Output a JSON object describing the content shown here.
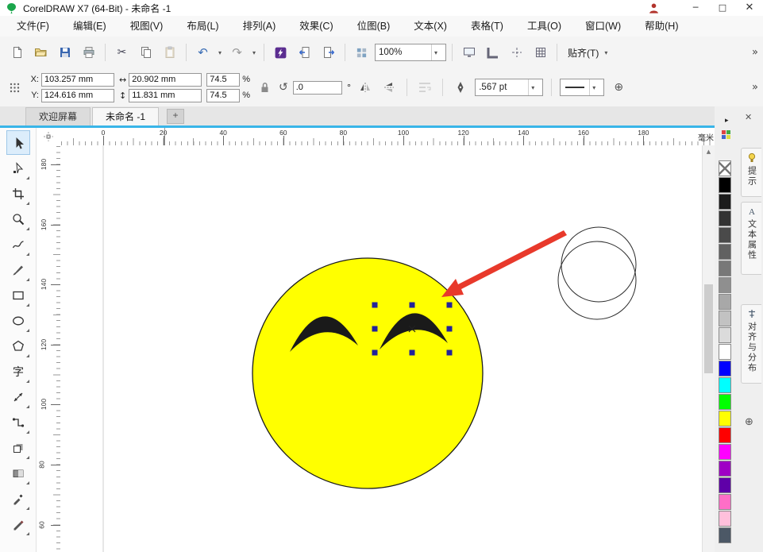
{
  "titlebar": {
    "title": "CorelDRAW X7 (64-Bit) - 未命名 -1",
    "minimize": "─",
    "maximize": "□",
    "close": "✕"
  },
  "menubar": {
    "items": [
      "文件(F)",
      "编辑(E)",
      "视图(V)",
      "布局(L)",
      "排列(A)",
      "效果(C)",
      "位图(B)",
      "文本(X)",
      "表格(T)",
      "工具(O)",
      "窗口(W)",
      "帮助(H)"
    ]
  },
  "toolbar": {
    "zoom_value": "100%",
    "snap_label": "贴齐(T)",
    "caret": "▾",
    "overflow": "»",
    "icons": {
      "cut": "✂",
      "undo": "↶",
      "redo": "↷"
    }
  },
  "propbar": {
    "x_label": "X:",
    "y_label": "Y:",
    "x_value": "103.257 mm",
    "y_value": "124.616 mm",
    "width_icon": "↔",
    "height_icon": "↕",
    "width_value": "20.902 mm",
    "height_value": "11.831 mm",
    "scale_h": "74.5",
    "scale_v": "74.5",
    "percent": "%",
    "rotate_icon": "↺",
    "rotate_value": ".0",
    "degree": "°",
    "outline_width": ".567 pt",
    "plus": "⊕",
    "overflow": "»"
  },
  "tabbar": {
    "tabs": [
      {
        "label": "欢迎屏幕",
        "active": false
      },
      {
        "label": "未命名 -1",
        "active": true
      }
    ],
    "new_tab": "+"
  },
  "rulers": {
    "h_ticks": [
      "0",
      "20",
      "40",
      "60",
      "80",
      "100",
      "120",
      "140",
      "160",
      "180"
    ],
    "v_ticks": [
      "180",
      "160",
      "140",
      "120",
      "100",
      "80",
      "60"
    ],
    "unit": "毫米"
  },
  "toolbox": {
    "text_tool_glyph": "字",
    "tools": [
      "pick",
      "shape",
      "crop",
      "zoom",
      "freehand",
      "artistic-media",
      "rectangle",
      "ellipse",
      "polygon",
      "text",
      "parallel-dimension",
      "connector",
      "drop-shadow",
      "transparency",
      "color-eyedropper",
      "outline-pen"
    ]
  },
  "palette": {
    "flyout_arrow": "▸",
    "colors": [
      {
        "name": "no-fill",
        "hex": ""
      },
      {
        "name": "black",
        "hex": "#000000"
      },
      {
        "name": "90-black",
        "hex": "#1c1c1c"
      },
      {
        "name": "80-black",
        "hex": "#333333"
      },
      {
        "name": "70-black",
        "hex": "#4a4a4a"
      },
      {
        "name": "60-black",
        "hex": "#616161"
      },
      {
        "name": "50-black",
        "hex": "#787878"
      },
      {
        "name": "40-black",
        "hex": "#8f8f8f"
      },
      {
        "name": "30-black",
        "hex": "#a8a8a8"
      },
      {
        "name": "20-black",
        "hex": "#c2c2c2"
      },
      {
        "name": "10-black",
        "hex": "#dbdbdb"
      },
      {
        "name": "white",
        "hex": "#ffffff"
      },
      {
        "name": "blue",
        "hex": "#0000ff"
      },
      {
        "name": "cyan",
        "hex": "#00ffff"
      },
      {
        "name": "green",
        "hex": "#00ff00"
      },
      {
        "name": "yellow",
        "hex": "#ffff00"
      },
      {
        "name": "red",
        "hex": "#ff0000"
      },
      {
        "name": "magenta",
        "hex": "#ff00ff"
      },
      {
        "name": "purple",
        "hex": "#9f00c5"
      },
      {
        "name": "violet",
        "hex": "#5f00a8"
      },
      {
        "name": "pink",
        "hex": "#ff6ec7"
      },
      {
        "name": "light-pink",
        "hex": "#ffc0dc"
      },
      {
        "name": "slate",
        "hex": "#4c5866"
      }
    ]
  },
  "dockers": {
    "close": "✕",
    "quick_customize": "⊕",
    "tabs": [
      {
        "label": "提示"
      },
      {
        "label": "文本属性"
      },
      {
        "label": "对齐与分布"
      }
    ]
  },
  "scrollbar": {
    "up_arrow": "▲"
  },
  "colors": {
    "accent": "#39b5e8",
    "selection_handles": "#22229a",
    "smiley_fill": "#ffff00",
    "arrow_red": "#e8392b"
  }
}
